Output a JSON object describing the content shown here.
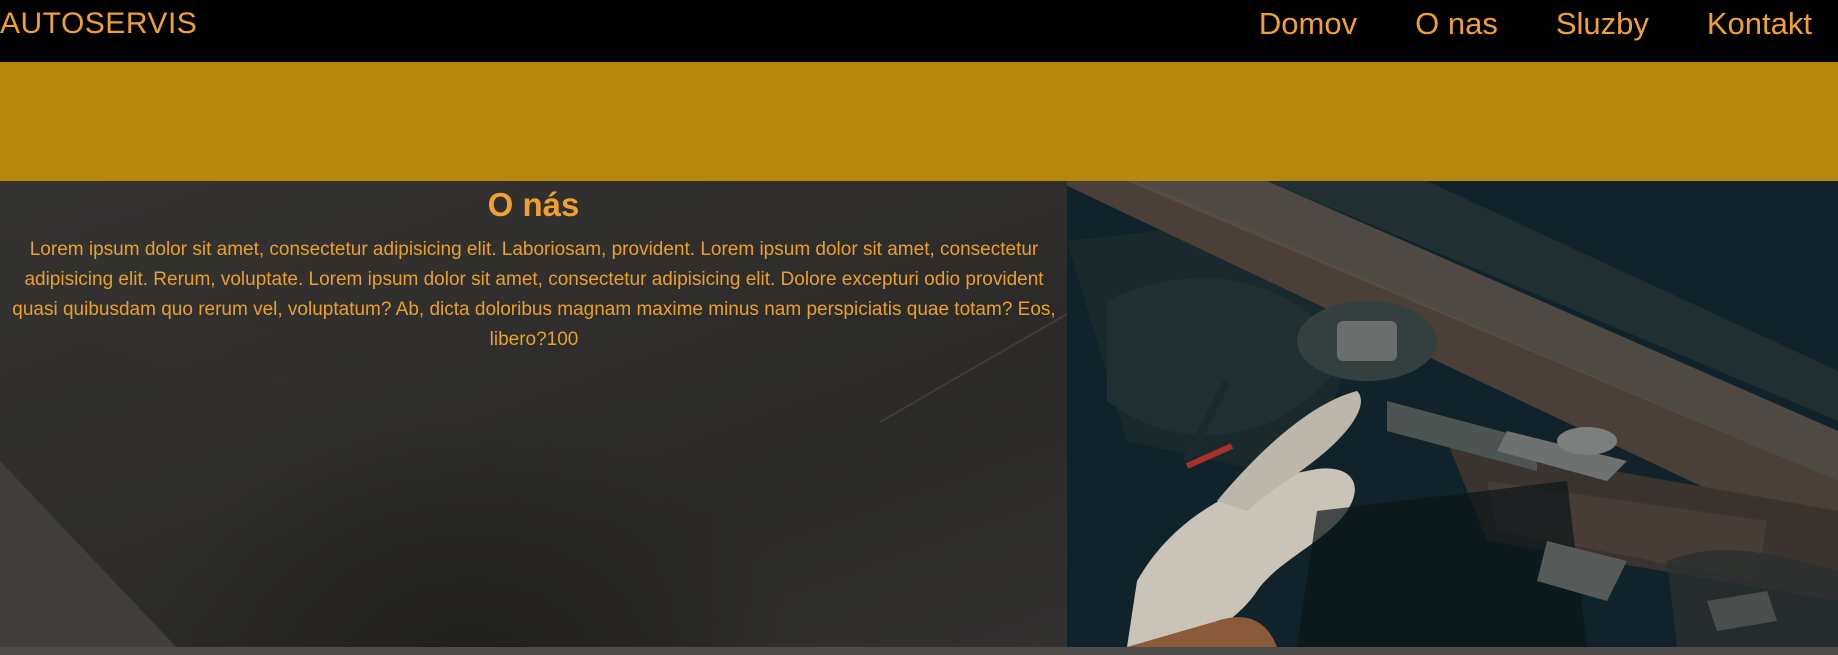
{
  "nav": {
    "logo": "AUTOSERVIS",
    "links": [
      {
        "label": "Domov"
      },
      {
        "label": "O nas"
      },
      {
        "label": "Sluzby"
      },
      {
        "label": "Kontakt"
      }
    ]
  },
  "about": {
    "title": "O nás",
    "text": "Lorem ipsum dolor sit amet, consectetur adipisicing elit. Laboriosam, provident. Lorem ipsum dolor sit amet, consectetur adipisicing elit. Rerum, voluptate. Lorem ipsum dolor sit amet, consectetur adipisicing elit. Dolore excepturi odio provident quasi quibusdam quo rerum vel, voluptatum? Ab, dicta doloribus magnam maxime minus nam perspiciatis quae totam? Eos, libero?100"
  },
  "colors": {
    "nav_background": "#000000",
    "accent": "#f0a030",
    "banner": "#b5870c",
    "about_background": "#2f2e2c"
  },
  "photo": {
    "icon": "car-repair-photo"
  }
}
